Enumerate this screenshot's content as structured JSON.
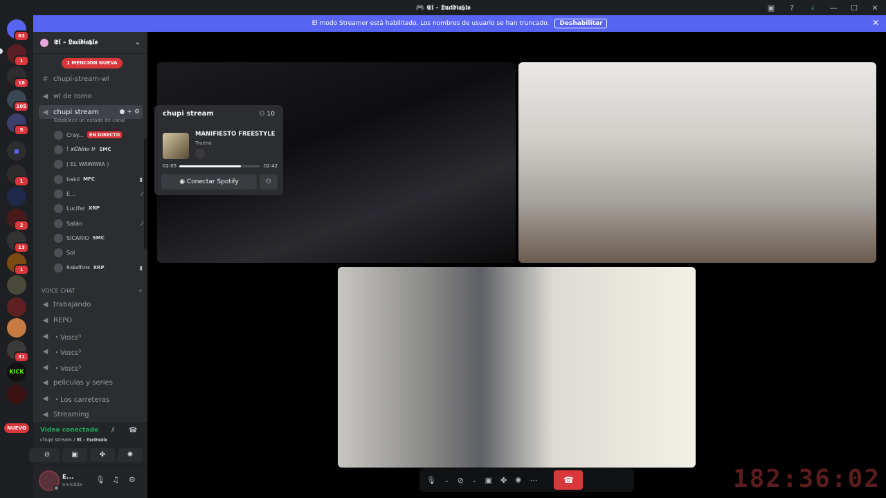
{
  "window": {
    "title": "🎮 𝕰𝖑 - 𝕷𝖚𝖈𝖎𝖉𝖎𝖆𝖇𝖑𝖔"
  },
  "banner": {
    "text": "El modo Streamer está habilitado. Los nombres de usuario se han truncado.",
    "button": "Deshabilitar"
  },
  "server_rail": {
    "badges": [
      "63",
      "1",
      "18",
      "105",
      "5",
      "1",
      "2",
      "13",
      "1",
      "31"
    ],
    "nuevo": "NUEVO"
  },
  "guild": {
    "name": "𝕰𝖑 - 𝕷𝖚𝖈𝖎𝖉𝖎𝖆𝖇𝖑𝖔",
    "mention_pill": "1 MENCIÓN NUEVA"
  },
  "channels": [
    {
      "name": "chupi-stream-wl",
      "type": "text"
    },
    {
      "name": "wl de romo",
      "type": "voice"
    },
    {
      "name": "chupi stream",
      "type": "voice",
      "active": true
    }
  ],
  "channel_status": "Establece un estado de canal",
  "members": [
    {
      "name": "Cray...",
      "tag": "",
      "live": "EN DIRECTO"
    },
    {
      "name": "! 𝒙𝑪𝒉𝒊𝒏𝒐 𝒇𝒓",
      "tag": "SMC",
      "live": ""
    },
    {
      "name": "( EL WAWAWA )",
      "tag": "",
      "live": ""
    },
    {
      "name": "bakil",
      "tag": "MFC",
      "live": ""
    },
    {
      "name": "E...",
      "tag": "",
      "live": ""
    },
    {
      "name": "Lucifer",
      "tag": "XRP",
      "live": ""
    },
    {
      "name": "Satán",
      "tag": "",
      "live": ""
    },
    {
      "name": "SICARIO",
      "tag": "SMC",
      "live": ""
    },
    {
      "name": "Sol",
      "tag": "",
      "live": ""
    },
    {
      "name": "𝕮𝖆𝖇𝖆𝖑𝖑𝖎𝖘𝖙𝖔",
      "tag": "XRP",
      "live": ""
    }
  ],
  "voice_category": "VOICE CHAT",
  "voice_channels": [
    "trabajando",
    "REPO",
    "・Voɪᴄᴇ³",
    "・Voɪᴄᴇ³",
    "・Voɪᴄᴇ³",
    "peliculas y series",
    "・Los carreteras",
    "Streaming"
  ],
  "voice_panel": {
    "status": "Video conectado",
    "location": "chupi stream / ",
    "guild": "𝕰𝖑 - 𝕷𝖚𝖈𝖎𝖉𝖎𝖆𝖇𝖑𝖔"
  },
  "user": {
    "name": "E...",
    "status": "Invisible"
  },
  "activity": {
    "channel": "chupi stream",
    "count": "10",
    "song": "MANIFIESTO FREESTYLE",
    "artist": "Trueno",
    "elapsed": "02:05",
    "total": "02:42",
    "progress": 0.77,
    "button": "Conectar Spotify"
  },
  "timer": "182:36:02"
}
